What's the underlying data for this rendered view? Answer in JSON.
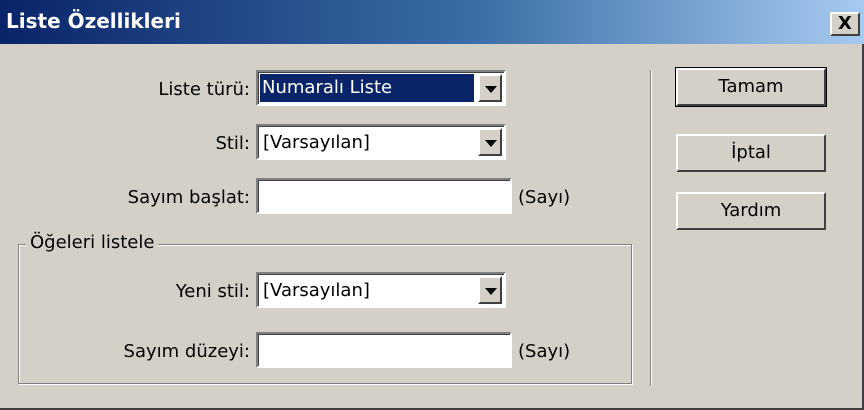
{
  "window": {
    "title": "Liste Özellikleri",
    "close_label": "X"
  },
  "form": {
    "list_type": {
      "label": "Liste türü:",
      "value": "Numaralı Liste"
    },
    "style": {
      "label": "Stil:",
      "value": "[Varsayılan]"
    },
    "start_count": {
      "label": "Sayım başlat:",
      "value": "",
      "unit": "(Sayı)"
    }
  },
  "list_items_group": {
    "label": "Öğeleri listele",
    "new_style": {
      "label": "Yeni stil:",
      "value": "[Varsayılan]"
    },
    "count_level": {
      "label": "Sayım düzeyi:",
      "value": "",
      "unit": "(Sayı)"
    }
  },
  "buttons": {
    "ok": "Tamam",
    "cancel": "İptal",
    "help": "Yardım"
  },
  "colors": {
    "title_bar_start": "#0a246a",
    "selection": "#0a246a",
    "dialog_face": "#d4d0c8"
  }
}
